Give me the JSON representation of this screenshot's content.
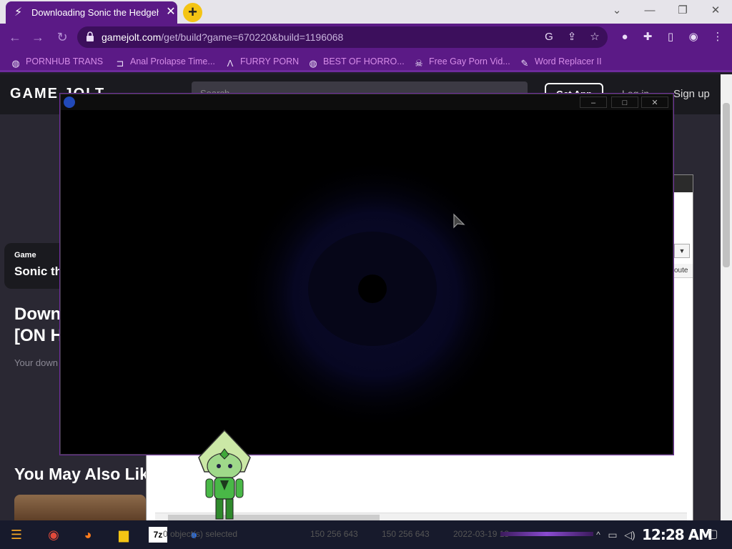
{
  "browser": {
    "tab_title": "Downloading Sonic the Hedgeh",
    "new_tab_label": "+",
    "url_host": "gamejolt.com",
    "url_path": "/get/build?game=670220&build=1196068",
    "bookmarks": [
      {
        "label": "PORNHUB TRANS",
        "icon": "globe-icon"
      },
      {
        "label": "Anal Prolapse Time...",
        "icon": "bracket-icon"
      },
      {
        "label": "FURRY PORN",
        "icon": "a-logo-icon"
      },
      {
        "label": "BEST OF HORRO...",
        "icon": "globe-icon"
      },
      {
        "label": "Free Gay Porn Vid...",
        "icon": "skull-icon"
      },
      {
        "label": "Word Replacer II",
        "icon": "wr-icon"
      }
    ],
    "accent_color": "#5b1a86"
  },
  "gamejolt": {
    "logo": "GAME JOLT",
    "search_placeholder": "Search",
    "get_app": "Get App",
    "login": "Log in",
    "signup": "Sign up",
    "game_label": "Game",
    "game_name": "Sonic th",
    "download_title_1": "Down",
    "download_title_2": "[ON H",
    "download_sub": "Your down",
    "also_like": "You May Also Lik"
  },
  "zip": {
    "dropdown_arrow": "▼",
    "column_fragment": "oute",
    "status_selected": "0 object(s) selected",
    "status_size1": "150 256 643",
    "status_size2": "150 256 643",
    "status_date": "2022-03-19 18"
  },
  "taskbar": {
    "clock": "12:28 AM",
    "apps": [
      "start",
      "chrome",
      "firefox",
      "explorer",
      "7-zip",
      "sonic"
    ],
    "seven_zip_label": "7z"
  }
}
